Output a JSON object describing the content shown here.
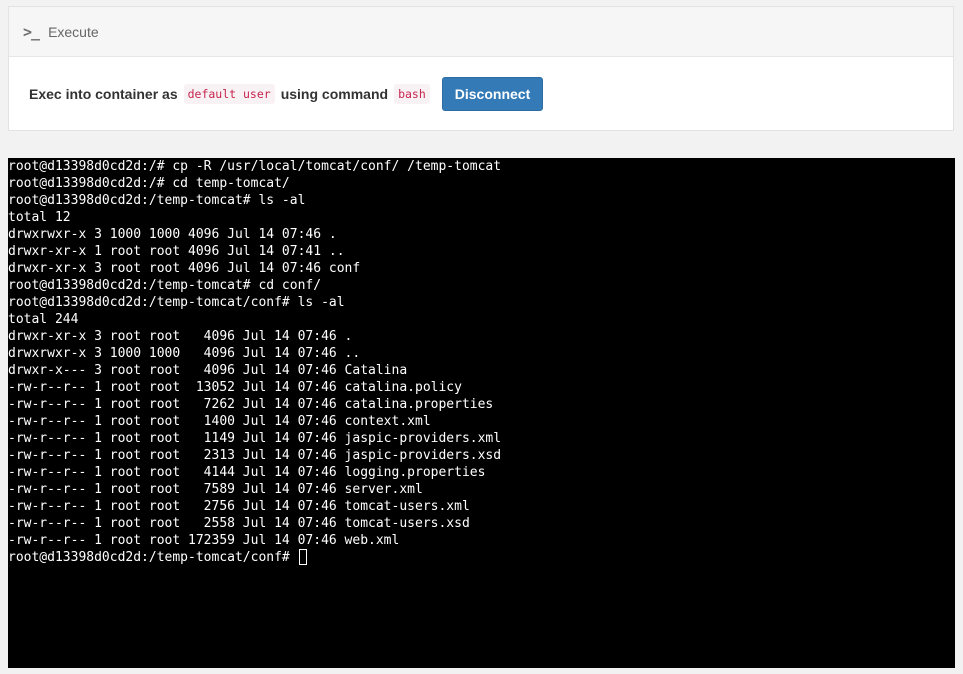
{
  "header": {
    "title": "Execute",
    "icon": "terminal-icon"
  },
  "exec": {
    "text_prefix": "Exec into container as",
    "user": "default user",
    "text_middle": "using command",
    "command": "bash",
    "disconnect_label": "Disconnect"
  },
  "terminal": {
    "lines": [
      "root@d13398d0cd2d:/# cp -R /usr/local/tomcat/conf/ /temp-tomcat",
      "root@d13398d0cd2d:/# cd temp-tomcat/",
      "root@d13398d0cd2d:/temp-tomcat# ls -al",
      "total 12",
      "drwxrwxr-x 3 1000 1000 4096 Jul 14 07:46 .",
      "drwxr-xr-x 1 root root 4096 Jul 14 07:41 ..",
      "drwxr-xr-x 3 root root 4096 Jul 14 07:46 conf",
      "root@d13398d0cd2d:/temp-tomcat# cd conf/",
      "root@d13398d0cd2d:/temp-tomcat/conf# ls -al",
      "total 244",
      "drwxr-xr-x 3 root root   4096 Jul 14 07:46 .",
      "drwxrwxr-x 3 1000 1000   4096 Jul 14 07:46 ..",
      "drwxr-x--- 3 root root   4096 Jul 14 07:46 Catalina",
      "-rw-r--r-- 1 root root  13052 Jul 14 07:46 catalina.policy",
      "-rw-r--r-- 1 root root   7262 Jul 14 07:46 catalina.properties",
      "-rw-r--r-- 1 root root   1400 Jul 14 07:46 context.xml",
      "-rw-r--r-- 1 root root   1149 Jul 14 07:46 jaspic-providers.xml",
      "-rw-r--r-- 1 root root   2313 Jul 14 07:46 jaspic-providers.xsd",
      "-rw-r--r-- 1 root root   4144 Jul 14 07:46 logging.properties",
      "-rw-r--r-- 1 root root   7589 Jul 14 07:46 server.xml",
      "-rw-r--r-- 1 root root   2756 Jul 14 07:46 tomcat-users.xml",
      "-rw-r--r-- 1 root root   2558 Jul 14 07:46 tomcat-users.xsd",
      "-rw-r--r-- 1 root root 172359 Jul 14 07:46 web.xml"
    ],
    "prompt": "root@d13398d0cd2d:/temp-tomcat/conf# "
  },
  "colors": {
    "accent": "#337ab7",
    "code_text": "#c7254e",
    "code_bg": "#f9f2f4",
    "terminal_bg": "#000000",
    "terminal_fg": "#ffffff"
  }
}
